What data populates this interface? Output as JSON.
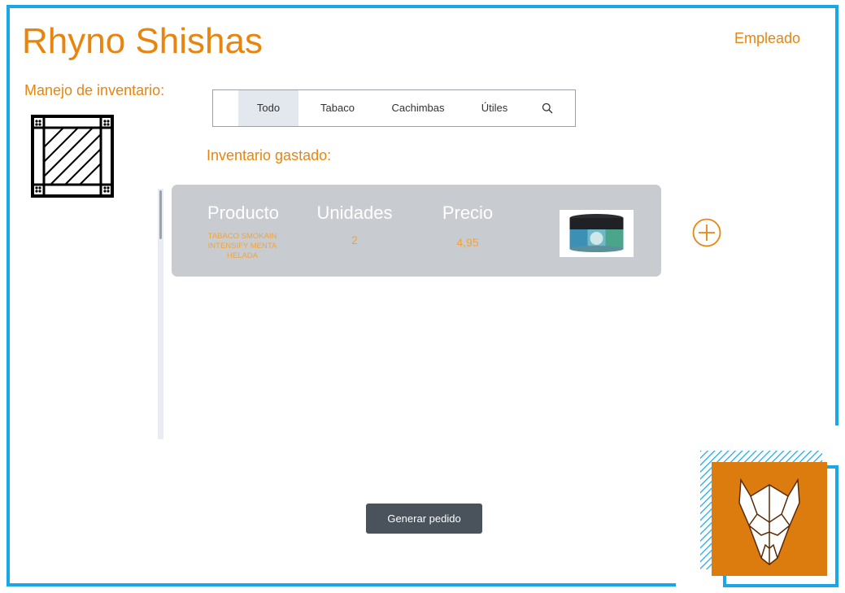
{
  "header": {
    "title": "Rhyno Shishas",
    "role_link": "Empleado"
  },
  "sidebar": {
    "section_label": "Manejo de inventario:",
    "icon": "crate-icon"
  },
  "tabs": [
    {
      "label": "Todo",
      "active": true
    },
    {
      "label": "Tabaco",
      "active": false
    },
    {
      "label": "Cachimbas",
      "active": false
    },
    {
      "label": "Útiles",
      "active": false
    }
  ],
  "tabs_search_icon": "search-icon",
  "main": {
    "subtitle": "Inventario gastado:",
    "columns": {
      "product": "Producto",
      "units": "Unidades",
      "price": "Precio"
    },
    "items": [
      {
        "product_name": "TABACO SMOKAIN INTENSIFY MENTA HELADA",
        "units": "2",
        "price": "4,95",
        "image": "product-jar-image"
      }
    ],
    "add_icon": "plus-circle-icon"
  },
  "footer": {
    "order_button": "Generar pedido"
  },
  "colors": {
    "accent": "#e8850f",
    "frame": "#1aa7e8",
    "card_bg": "#c8ccd1",
    "button_bg": "#4a525c",
    "logo_bg": "#e8850f"
  }
}
